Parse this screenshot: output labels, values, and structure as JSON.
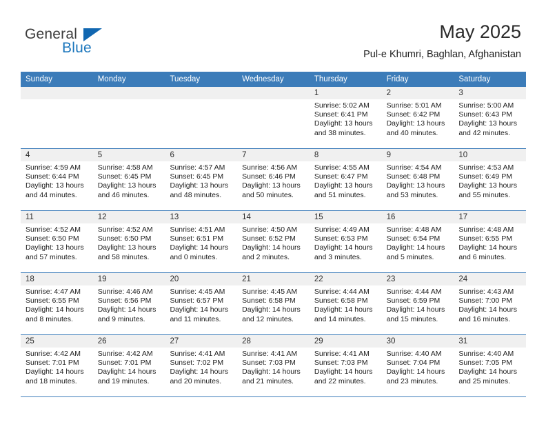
{
  "brand": {
    "name_part1": "General",
    "name_part2": "Blue",
    "accent_color": "#1167b1",
    "header_color": "#3c7cb9"
  },
  "header": {
    "month_title": "May 2025",
    "location": "Pul-e Khumri, Baghlan, Afghanistan"
  },
  "weekdays": [
    "Sunday",
    "Monday",
    "Tuesday",
    "Wednesday",
    "Thursday",
    "Friday",
    "Saturday"
  ],
  "weeks": [
    [
      {
        "day": "",
        "sunrise": "",
        "sunset": "",
        "daylight": "",
        "empty": true
      },
      {
        "day": "",
        "sunrise": "",
        "sunset": "",
        "daylight": "",
        "empty": true
      },
      {
        "day": "",
        "sunrise": "",
        "sunset": "",
        "daylight": "",
        "empty": true
      },
      {
        "day": "",
        "sunrise": "",
        "sunset": "",
        "daylight": "",
        "empty": true
      },
      {
        "day": "1",
        "sunrise": "Sunrise: 5:02 AM",
        "sunset": "Sunset: 6:41 PM",
        "daylight": "Daylight: 13 hours and 38 minutes."
      },
      {
        "day": "2",
        "sunrise": "Sunrise: 5:01 AM",
        "sunset": "Sunset: 6:42 PM",
        "daylight": "Daylight: 13 hours and 40 minutes."
      },
      {
        "day": "3",
        "sunrise": "Sunrise: 5:00 AM",
        "sunset": "Sunset: 6:43 PM",
        "daylight": "Daylight: 13 hours and 42 minutes."
      }
    ],
    [
      {
        "day": "4",
        "sunrise": "Sunrise: 4:59 AM",
        "sunset": "Sunset: 6:44 PM",
        "daylight": "Daylight: 13 hours and 44 minutes."
      },
      {
        "day": "5",
        "sunrise": "Sunrise: 4:58 AM",
        "sunset": "Sunset: 6:45 PM",
        "daylight": "Daylight: 13 hours and 46 minutes."
      },
      {
        "day": "6",
        "sunrise": "Sunrise: 4:57 AM",
        "sunset": "Sunset: 6:45 PM",
        "daylight": "Daylight: 13 hours and 48 minutes."
      },
      {
        "day": "7",
        "sunrise": "Sunrise: 4:56 AM",
        "sunset": "Sunset: 6:46 PM",
        "daylight": "Daylight: 13 hours and 50 minutes."
      },
      {
        "day": "8",
        "sunrise": "Sunrise: 4:55 AM",
        "sunset": "Sunset: 6:47 PM",
        "daylight": "Daylight: 13 hours and 51 minutes."
      },
      {
        "day": "9",
        "sunrise": "Sunrise: 4:54 AM",
        "sunset": "Sunset: 6:48 PM",
        "daylight": "Daylight: 13 hours and 53 minutes."
      },
      {
        "day": "10",
        "sunrise": "Sunrise: 4:53 AM",
        "sunset": "Sunset: 6:49 PM",
        "daylight": "Daylight: 13 hours and 55 minutes."
      }
    ],
    [
      {
        "day": "11",
        "sunrise": "Sunrise: 4:52 AM",
        "sunset": "Sunset: 6:50 PM",
        "daylight": "Daylight: 13 hours and 57 minutes."
      },
      {
        "day": "12",
        "sunrise": "Sunrise: 4:52 AM",
        "sunset": "Sunset: 6:50 PM",
        "daylight": "Daylight: 13 hours and 58 minutes."
      },
      {
        "day": "13",
        "sunrise": "Sunrise: 4:51 AM",
        "sunset": "Sunset: 6:51 PM",
        "daylight": "Daylight: 14 hours and 0 minutes."
      },
      {
        "day": "14",
        "sunrise": "Sunrise: 4:50 AM",
        "sunset": "Sunset: 6:52 PM",
        "daylight": "Daylight: 14 hours and 2 minutes."
      },
      {
        "day": "15",
        "sunrise": "Sunrise: 4:49 AM",
        "sunset": "Sunset: 6:53 PM",
        "daylight": "Daylight: 14 hours and 3 minutes."
      },
      {
        "day": "16",
        "sunrise": "Sunrise: 4:48 AM",
        "sunset": "Sunset: 6:54 PM",
        "daylight": "Daylight: 14 hours and 5 minutes."
      },
      {
        "day": "17",
        "sunrise": "Sunrise: 4:48 AM",
        "sunset": "Sunset: 6:55 PM",
        "daylight": "Daylight: 14 hours and 6 minutes."
      }
    ],
    [
      {
        "day": "18",
        "sunrise": "Sunrise: 4:47 AM",
        "sunset": "Sunset: 6:55 PM",
        "daylight": "Daylight: 14 hours and 8 minutes."
      },
      {
        "day": "19",
        "sunrise": "Sunrise: 4:46 AM",
        "sunset": "Sunset: 6:56 PM",
        "daylight": "Daylight: 14 hours and 9 minutes."
      },
      {
        "day": "20",
        "sunrise": "Sunrise: 4:45 AM",
        "sunset": "Sunset: 6:57 PM",
        "daylight": "Daylight: 14 hours and 11 minutes."
      },
      {
        "day": "21",
        "sunrise": "Sunrise: 4:45 AM",
        "sunset": "Sunset: 6:58 PM",
        "daylight": "Daylight: 14 hours and 12 minutes."
      },
      {
        "day": "22",
        "sunrise": "Sunrise: 4:44 AM",
        "sunset": "Sunset: 6:58 PM",
        "daylight": "Daylight: 14 hours and 14 minutes."
      },
      {
        "day": "23",
        "sunrise": "Sunrise: 4:44 AM",
        "sunset": "Sunset: 6:59 PM",
        "daylight": "Daylight: 14 hours and 15 minutes."
      },
      {
        "day": "24",
        "sunrise": "Sunrise: 4:43 AM",
        "sunset": "Sunset: 7:00 PM",
        "daylight": "Daylight: 14 hours and 16 minutes."
      }
    ],
    [
      {
        "day": "25",
        "sunrise": "Sunrise: 4:42 AM",
        "sunset": "Sunset: 7:01 PM",
        "daylight": "Daylight: 14 hours and 18 minutes."
      },
      {
        "day": "26",
        "sunrise": "Sunrise: 4:42 AM",
        "sunset": "Sunset: 7:01 PM",
        "daylight": "Daylight: 14 hours and 19 minutes."
      },
      {
        "day": "27",
        "sunrise": "Sunrise: 4:41 AM",
        "sunset": "Sunset: 7:02 PM",
        "daylight": "Daylight: 14 hours and 20 minutes."
      },
      {
        "day": "28",
        "sunrise": "Sunrise: 4:41 AM",
        "sunset": "Sunset: 7:03 PM",
        "daylight": "Daylight: 14 hours and 21 minutes."
      },
      {
        "day": "29",
        "sunrise": "Sunrise: 4:41 AM",
        "sunset": "Sunset: 7:03 PM",
        "daylight": "Daylight: 14 hours and 22 minutes."
      },
      {
        "day": "30",
        "sunrise": "Sunrise: 4:40 AM",
        "sunset": "Sunset: 7:04 PM",
        "daylight": "Daylight: 14 hours and 23 minutes."
      },
      {
        "day": "31",
        "sunrise": "Sunrise: 4:40 AM",
        "sunset": "Sunset: 7:05 PM",
        "daylight": "Daylight: 14 hours and 25 minutes."
      }
    ]
  ]
}
